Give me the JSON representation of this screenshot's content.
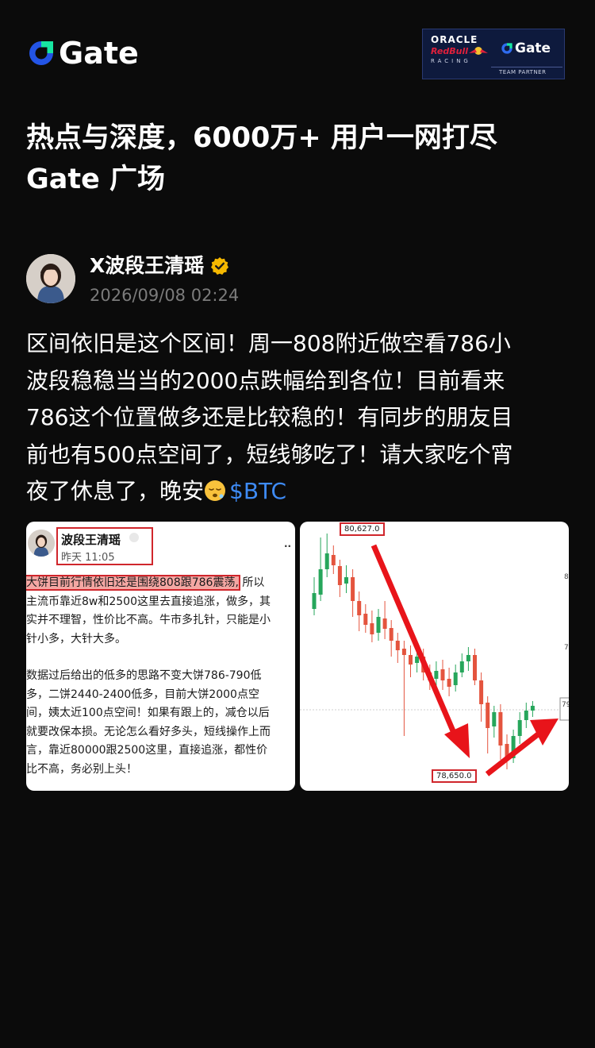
{
  "brand": {
    "name": "Gate",
    "accent": "#2354e6",
    "accent2": "#17e6a1"
  },
  "partner_badge": {
    "line1": "ORACLE",
    "line2": "RedBull",
    "line3": "RACING",
    "brand": "Gate",
    "caption": "TEAM PARTNER"
  },
  "headline": {
    "line1": "热点与深度，6000万+ 用户一网打尽",
    "line2": "Gate 广场"
  },
  "post": {
    "author": "X波段王清瑶",
    "timestamp": "2026/09/08 02:24",
    "lines": [
      "区间依旧是这个区间！周一808附近做空看786小",
      "波段稳稳当当的2000点跌幅给到各位！目前看来",
      "786这个位置做多还是比较稳的！有同步的朋友目",
      "前也有500点空间了，短线够吃了！请大家吃个宵"
    ],
    "last_line_text": "夜了休息了，晚安",
    "last_line_emoji": "sleeping-face-icon",
    "tag": "$BTC"
  },
  "screenshot_left": {
    "name": "波段王清瑶",
    "time": "昨天 11:05",
    "dots": "··",
    "highlight": "大饼目前行情依旧还是围绕808跟786震荡,",
    "highlight_tail": " 所以",
    "lines": [
      "主流币靠近8w和2500这里去直接追涨，做多，其",
      "实并不理智，性价比不高。牛市多扎针，只能是小",
      "针小多，大针大多。"
    ],
    "lines2": [
      " 数据过后给出的低多的思路不变大饼786-790低",
      "多，二饼2440-2400低多，目前大饼2000点空",
      "间，姨太近100点空间！如果有跟上的，减仓以后",
      "就要改保本损。无论怎么看好多头，短线操作上而",
      "言，靠近80000跟2500这里，直接追涨，都性价",
      "比不高，务必别上头！"
    ]
  },
  "screenshot_right": {
    "high_label": "80,627.0",
    "low_label": "78,650.0",
    "right_tick_1": "8",
    "right_tick_2": "7",
    "right_price": "79",
    "colors": {
      "up": "#26a65b",
      "down": "#e4543e",
      "arrow": "#e8141a"
    }
  }
}
